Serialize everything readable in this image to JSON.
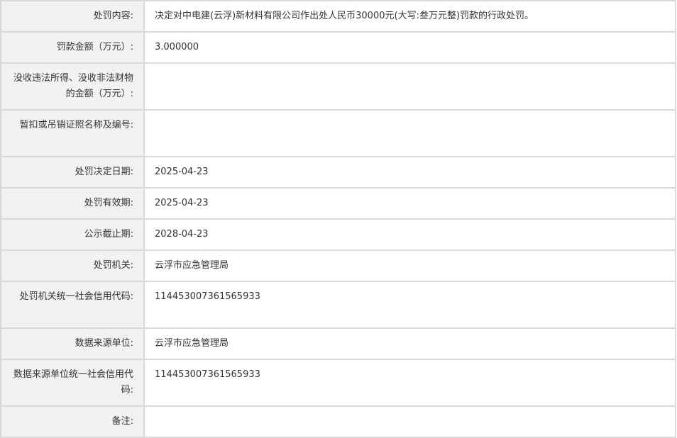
{
  "rows": [
    {
      "label": "处罚内容:",
      "value": "决定对中电建(云浮)新材料有限公司作出处人民币30000元(大写:叁万元整)罚款的行政处罚。"
    },
    {
      "label": "罚款金额（万元）:",
      "value": "3.000000"
    },
    {
      "label": "没收违法所得、没收非法财物的金额（万元）:",
      "value": ""
    },
    {
      "label": "暂扣或吊销证照名称及编号:",
      "value": ""
    },
    {
      "label": "处罚决定日期:",
      "value": "2025-04-23"
    },
    {
      "label": "处罚有效期:",
      "value": "2025-04-23"
    },
    {
      "label": "公示截止期:",
      "value": "2028-04-23"
    },
    {
      "label": "处罚机关:",
      "value": "云浮市应急管理局"
    },
    {
      "label": "处罚机关统一社会信用代码:",
      "value": "114453007361565933"
    },
    {
      "label": "数据来源单位:",
      "value": "云浮市应急管理局"
    },
    {
      "label": "数据来源单位统一社会信用代码:",
      "value": "114453007361565933"
    },
    {
      "label": "备注:",
      "value": ""
    }
  ]
}
